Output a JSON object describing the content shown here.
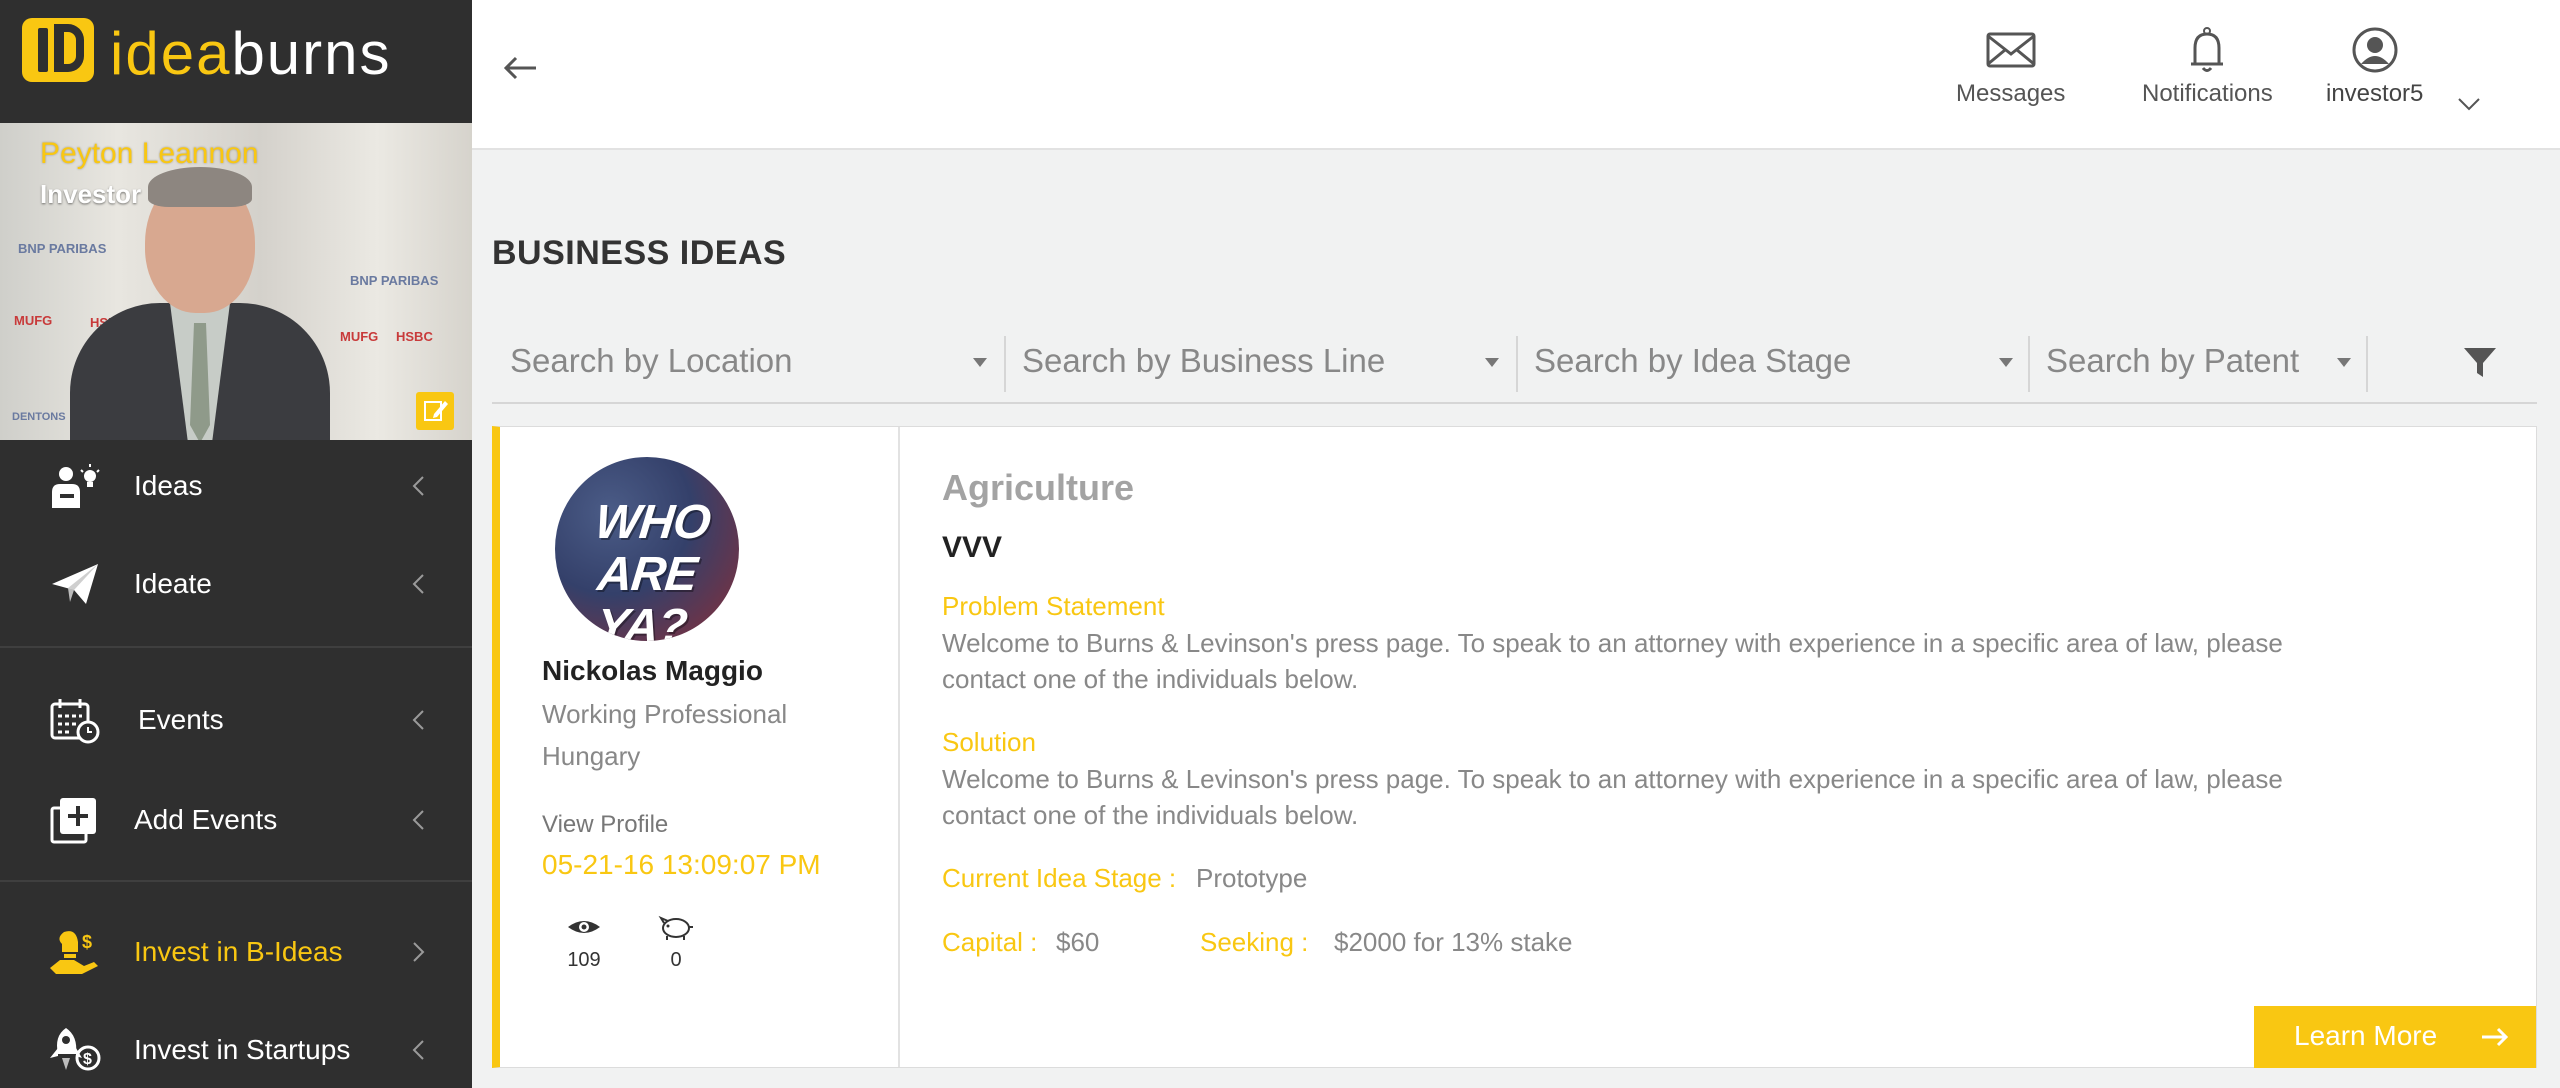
{
  "brand": {
    "idea": "idea",
    "burns": "burns",
    "accent": "#f9c712",
    "sidebar_bg": "#2f2f2f"
  },
  "profile": {
    "name": "Peyton Leannon",
    "role": "Investor",
    "sponsors": [
      "BNP PARIBAS",
      "MUFG",
      "HSBC",
      "BNP PARIBAS",
      "MUFG",
      "HSBC",
      "DENTONS"
    ]
  },
  "nav": [
    {
      "label": "Ideas",
      "icon": "ideas-person-bulb-icon"
    },
    {
      "label": "Ideate",
      "icon": "paper-plane-icon"
    },
    {
      "label": "Events",
      "icon": "calendar-clock-icon"
    },
    {
      "label": "Add Events",
      "icon": "add-box-icon"
    },
    {
      "label": "Invest in B-Ideas",
      "icon": "hand-bulb-dollar-icon",
      "active": true
    },
    {
      "label": "Invest in Startups",
      "icon": "rocket-dollar-icon"
    }
  ],
  "header": {
    "messages": "Messages",
    "notifications": "Notifications",
    "user": "investor5"
  },
  "page_title": "BUSINESS IDEAS",
  "filters": [
    {
      "label": "Search by Location"
    },
    {
      "label": "Search by Business Line"
    },
    {
      "label": "Search by Idea Stage"
    },
    {
      "label": "Search by Patent"
    }
  ],
  "idea": {
    "avatar_text": "WHO ARE YA?",
    "poster_name": "Nickolas Maggio",
    "occupation": "Working Professional",
    "country": "Hungary",
    "view_profile": "View Profile",
    "date": "05-21-16 13:09:07 PM",
    "views": "109",
    "investments": "0",
    "category": "Agriculture",
    "title": "VVV",
    "problem_label": "Problem Statement",
    "problem_text": "Welcome to Burns & Levinson's press page. To speak to an attorney with experience in a specific area of law, please contact one of the individuals below.",
    "solution_label": "Solution",
    "solution_text": "Welcome to Burns & Levinson's press page. To speak to an attorney with experience in a specific area of law, please contact one of the individuals below.",
    "stage_label": "Current Idea Stage :",
    "stage_value": "Prototype",
    "capital_label": "Capital :",
    "capital_value": "$60",
    "seeking_label": "Seeking :",
    "seeking_value": "$2000 for 13% stake",
    "learn_more": "Learn More"
  }
}
